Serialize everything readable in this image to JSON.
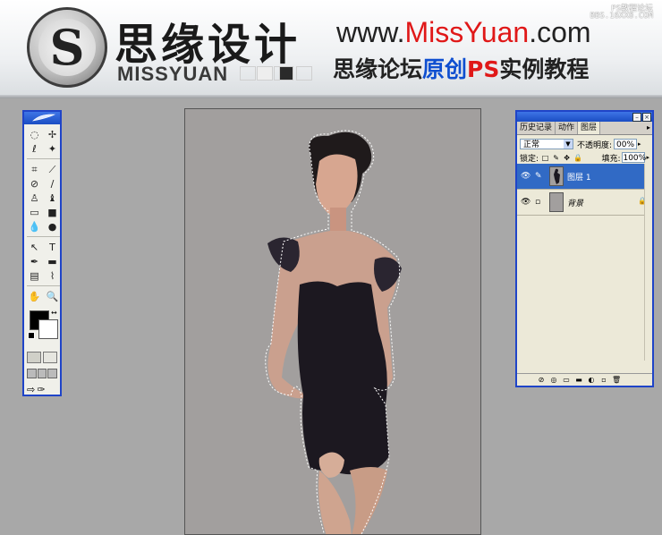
{
  "banner": {
    "logo_letter": "S",
    "brand_cn": "思缘设计",
    "brand_en": "MISSYUAN",
    "url_prefix": "www.",
    "url_red": "MissYuan",
    "url_suffix": ".com",
    "tagline_a": "思缘论坛",
    "tagline_b": "原创",
    "tagline_c": "PS",
    "tagline_d": "实例教程",
    "watermark_1": "PS教程论坛",
    "watermark_2": "BBS.16XX8.COM",
    "swatches": [
      "#ffffff",
      "#eeeeee",
      "#ffffff",
      "#2a2a2a",
      "#ffffff"
    ]
  },
  "toolbox": {
    "tools": [
      "marquee-icon",
      "move-icon",
      "lasso-icon",
      "magic-wand-icon",
      "crop-icon",
      "slice-icon",
      "healing-brush-icon",
      "brush-icon",
      "clone-stamp-icon",
      "history-brush-icon",
      "eraser-icon",
      "gradient-icon",
      "blur-icon",
      "dodge-icon",
      "path-selection-icon",
      "type-icon",
      "pen-icon",
      "shape-icon",
      "notes-icon",
      "eyedropper-icon",
      "hand-icon",
      "zoom-icon"
    ],
    "tool_glyphs": [
      "◌",
      "✢",
      "ℓ",
      "✦",
      "⌗",
      "⟋",
      "⊘",
      "∕",
      "♙",
      "♝",
      "▭",
      "■",
      "💧",
      "●",
      "↖",
      "T",
      "✒",
      "▬",
      "▤",
      "⌇",
      "✋",
      "🔍"
    ],
    "foreground": "#000000",
    "background": "#ffffff"
  },
  "panel": {
    "tabs": [
      "历史记录",
      "动作",
      "图层"
    ],
    "active_tab": "图层",
    "blend_mode": "正常",
    "opacity_label": "不透明度:",
    "opacity_value": "00%",
    "lock_label": "锁定:",
    "fill_label": "填充:",
    "fill_value": "100%",
    "layers": [
      {
        "name": "图层 1",
        "selected": true
      },
      {
        "name": "背景",
        "selected": false
      }
    ]
  },
  "colors": {
    "title_blue": "#1f44c8",
    "selection_blue": "#316ac5",
    "canvas_gray": "#a29f9e",
    "accent_red": "#e01818"
  }
}
